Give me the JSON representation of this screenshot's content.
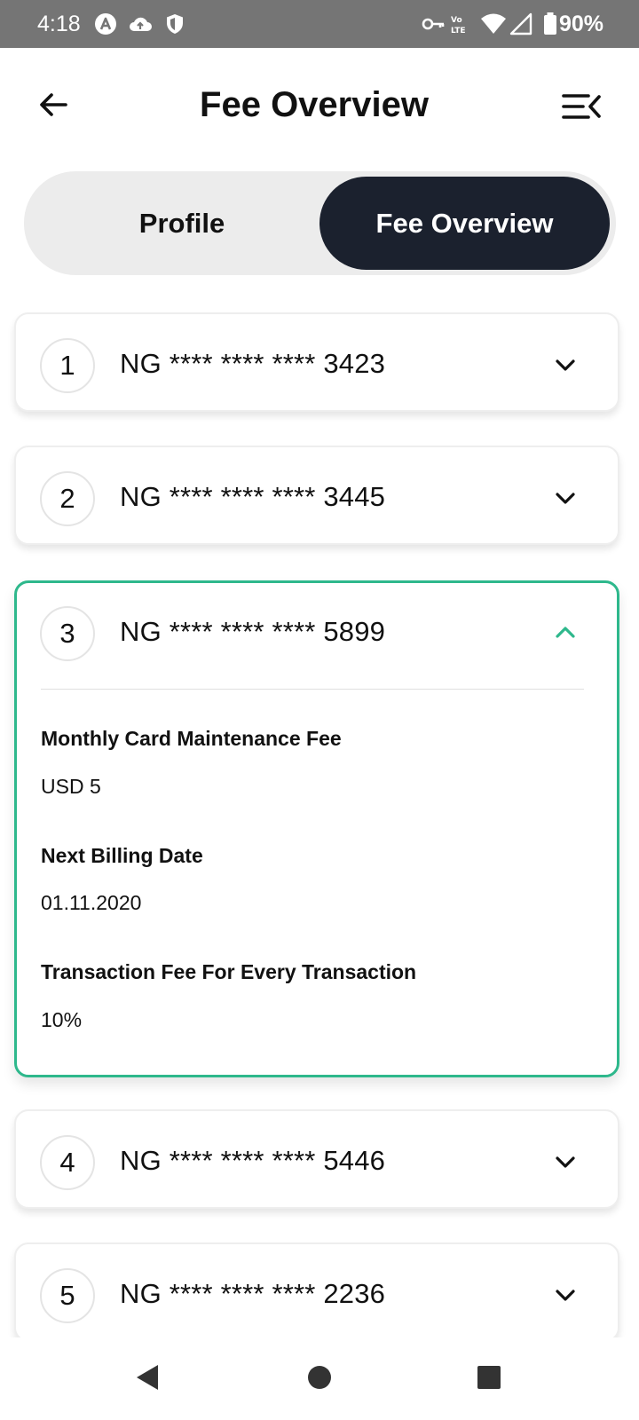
{
  "status_bar": {
    "time": "4:18",
    "battery": "90%",
    "icons": [
      "assistant-icon",
      "cloud-upload-icon",
      "shield-icon",
      "vpn-key-icon",
      "volte-icon",
      "wifi-icon",
      "signal-icon",
      "battery-icon"
    ]
  },
  "header": {
    "title": "Fee Overview",
    "back_icon": "arrow-left-icon",
    "menu_icon": "menu-collapse-icon"
  },
  "tabs": [
    {
      "label": "Profile",
      "active": false
    },
    {
      "label": "Fee Overview",
      "active": true
    }
  ],
  "cards": [
    {
      "number": "1",
      "account": "NG **** **** **** 3423",
      "expanded": false
    },
    {
      "number": "2",
      "account": "NG **** **** **** 3445",
      "expanded": false
    },
    {
      "number": "3",
      "account": "NG **** **** **** 5899",
      "expanded": true,
      "details": [
        {
          "label": "Monthly Card Maintenance Fee",
          "value": "USD 5"
        },
        {
          "label": "Next Billing Date",
          "value": "01.11.2020"
        },
        {
          "label": "Transaction Fee For Every Transaction",
          "value": "10%"
        }
      ]
    },
    {
      "number": "4",
      "account": "NG **** **** **** 5446",
      "expanded": false
    },
    {
      "number": "5",
      "account": "NG **** **** **** 2236",
      "expanded": false
    }
  ],
  "colors": {
    "accent": "#2eb88c",
    "active_tab_bg": "#1b212e",
    "segment_bg": "#ececec",
    "status_bar_bg": "#757575"
  },
  "nav_bar": {
    "icons": [
      "back-triangle-icon",
      "home-circle-icon",
      "recents-square-icon"
    ]
  }
}
